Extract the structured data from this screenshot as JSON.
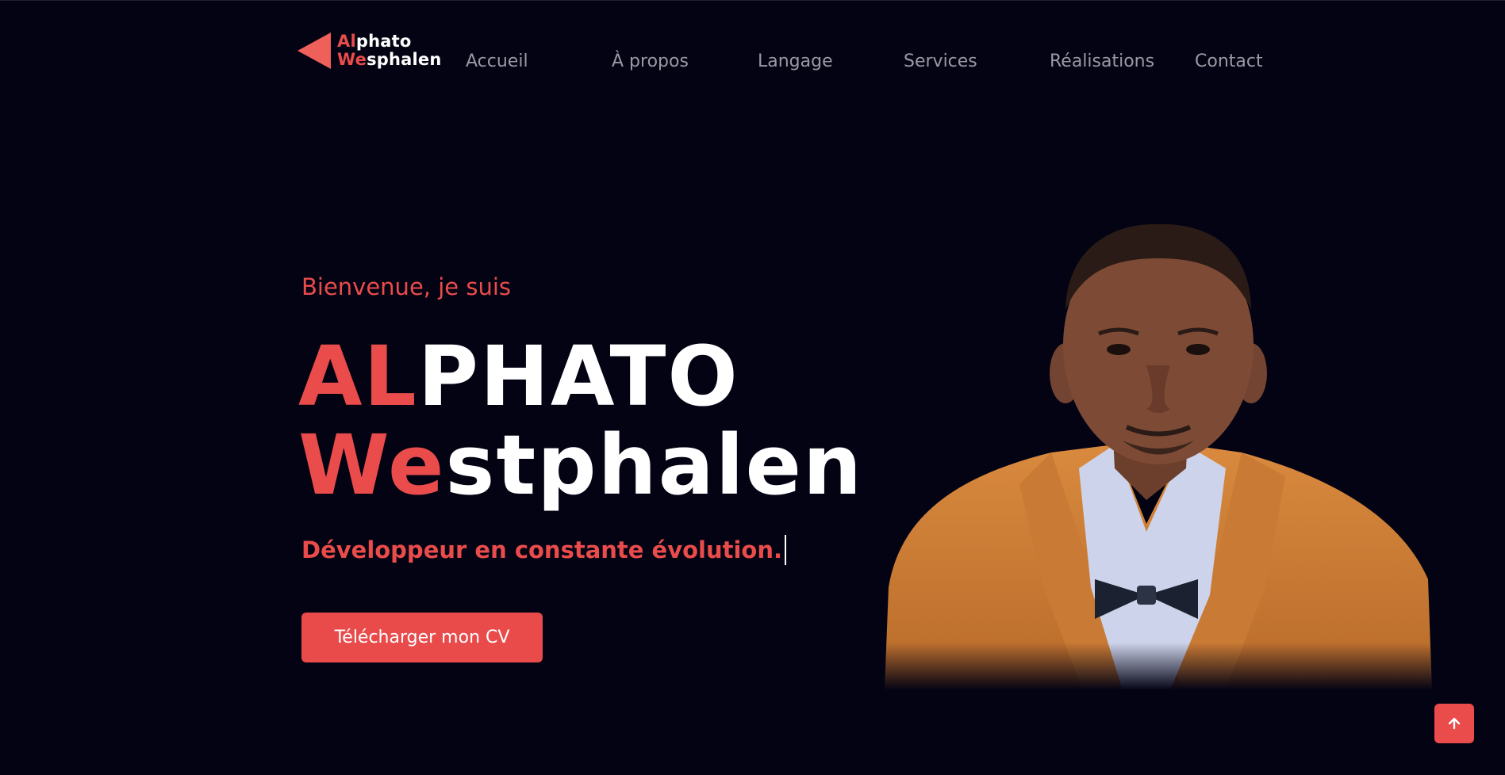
{
  "logo": {
    "line1_accent": "Al",
    "line1_rest": "phato",
    "line2_accent": "We",
    "line2_rest": "sphalen"
  },
  "nav": {
    "items": [
      {
        "label": "Accueil"
      },
      {
        "label": "À propos"
      },
      {
        "label": "Langage"
      },
      {
        "label": "Services"
      },
      {
        "label": "Réalisations"
      },
      {
        "label": "Contact"
      }
    ]
  },
  "hero": {
    "greeting": "Bienvenue, je suis",
    "first_name_accent": "AL",
    "first_name_rest": "PHATO",
    "last_name_accent": "We",
    "last_name_rest": "stphalen",
    "tagline": "Développeur en constante évolution.",
    "cv_button": "Télécharger mon CV"
  },
  "colors": {
    "background": "#030314",
    "accent": "#ea4b4b",
    "nav_text": "#9a9aa4",
    "text": "#ffffff"
  },
  "icons": {
    "logo": "triangle-logo-icon",
    "scroll_top": "arrow-up-icon"
  }
}
